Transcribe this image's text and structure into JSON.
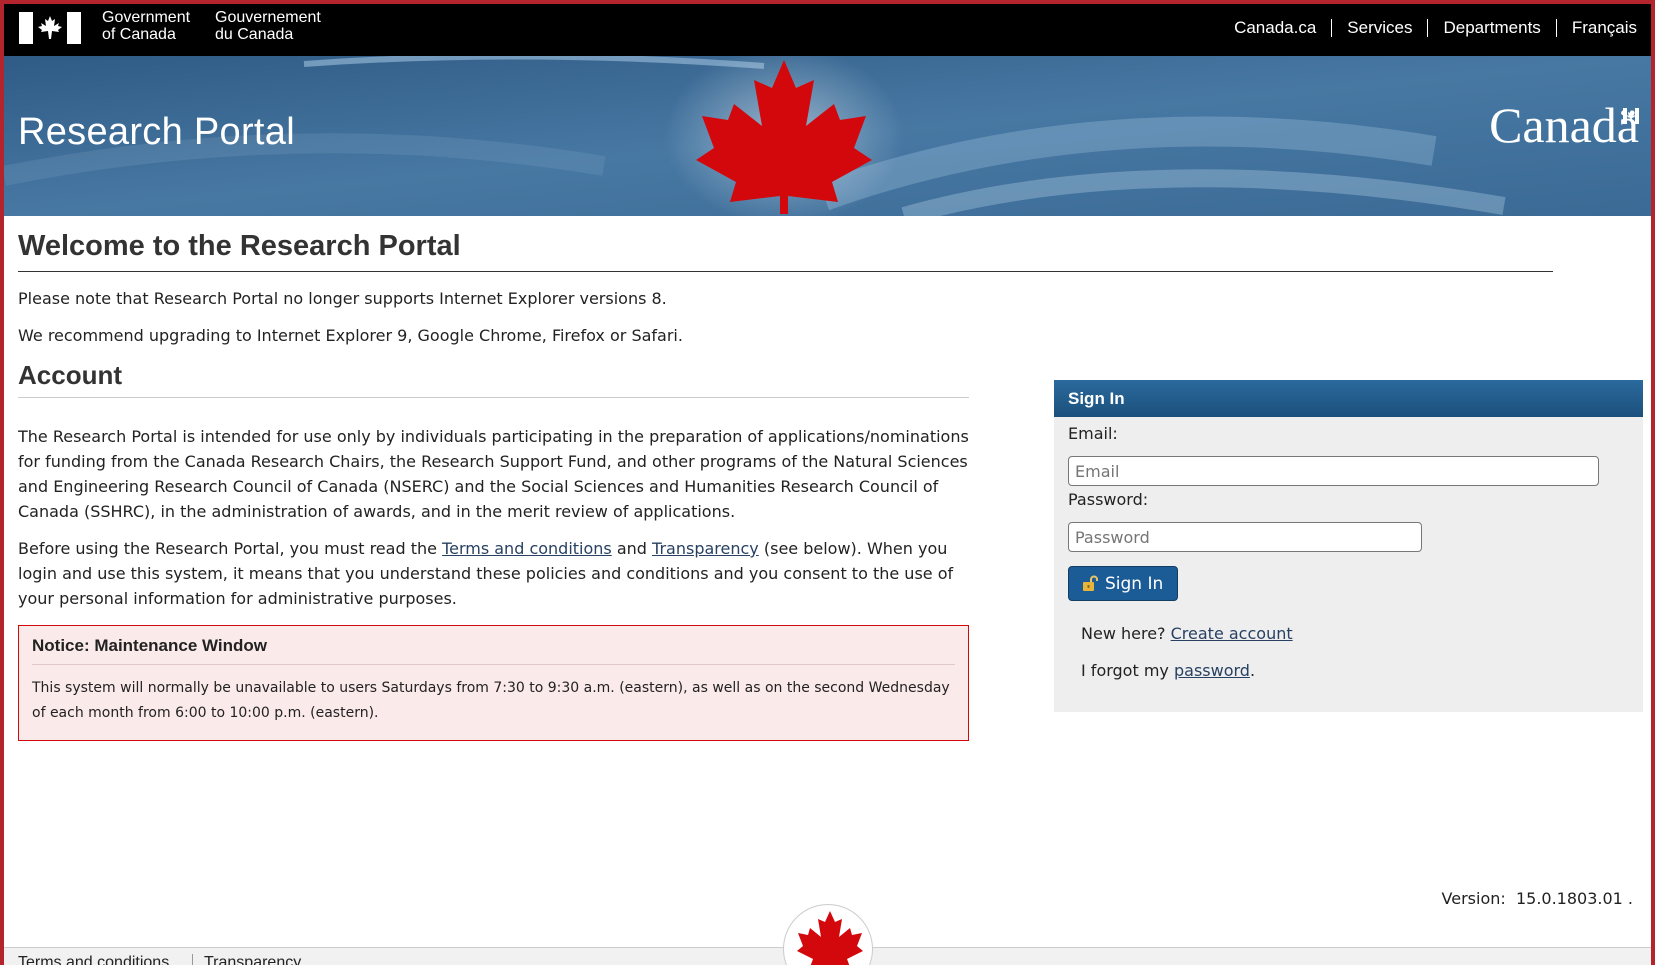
{
  "header": {
    "gov_en": [
      "Government",
      "of Canada"
    ],
    "gov_fr": [
      "Gouvernement",
      "du Canada"
    ],
    "nav": [
      "Canada.ca",
      "Services",
      "Departments",
      "Français"
    ]
  },
  "banner": {
    "title": "Research Portal",
    "wordmark": "Canadä"
  },
  "main": {
    "title": "Welcome to the Research Portal",
    "browser_note_1": "Please note that Research Portal no longer supports Internet Explorer versions 8.",
    "browser_note_2": "We recommend upgrading to Internet Explorer 9, Google Chrome, Firefox or Safari."
  },
  "account": {
    "title": "Account",
    "intro": "The Research Portal is intended for use only by individuals participating in the preparation of applications/nominations for funding from the Canada Research Chairs, the Research Support Fund, and other programs of the Natural Sciences and Engineering Research Council of Canada (NSERC) and the Social Sciences and Humanities Research Council of Canada (SSHRC), in the administration of awards, and in the merit review of applications.",
    "terms_prefix": "Before using the Research Portal, you must read the",
    "terms_link": "Terms and conditions",
    "terms_and": "and",
    "transparency_link": "Transparency",
    "terms_suffix": "(see below). When you login and use this system, it means that you understand these policies and conditions and you consent to the use of your personal information for administrative purposes."
  },
  "notice": {
    "title": "Notice: Maintenance Window",
    "body": "This system will normally be unavailable to users Saturdays from 7:30 to 9:30 a.m. (eastern), as well as on the second Wednesday of each month from 6:00 to 10:00 p.m. (eastern)."
  },
  "signin": {
    "title": "Sign In",
    "email_label": "Email:",
    "email_placeholder": "Email",
    "password_label": "Password:",
    "password_placeholder": "Password",
    "button": "Sign In",
    "new_here": "New here?",
    "create_account": "Create account",
    "forgot_prefix": "I forgot my",
    "forgot_link": "password",
    "forgot_suffix": "."
  },
  "version": {
    "label": "Version:",
    "value": "15.0.1803.01 ."
  },
  "footer": {
    "links": [
      "Terms and conditions",
      "Transparency"
    ]
  },
  "colors": {
    "fip_bar": "#000000",
    "banner_blue": "#3c6790",
    "maple_red": "#d3080c",
    "signin_header": "#1b507c",
    "link": "#284162",
    "notice_bg": "#fbeaea"
  }
}
